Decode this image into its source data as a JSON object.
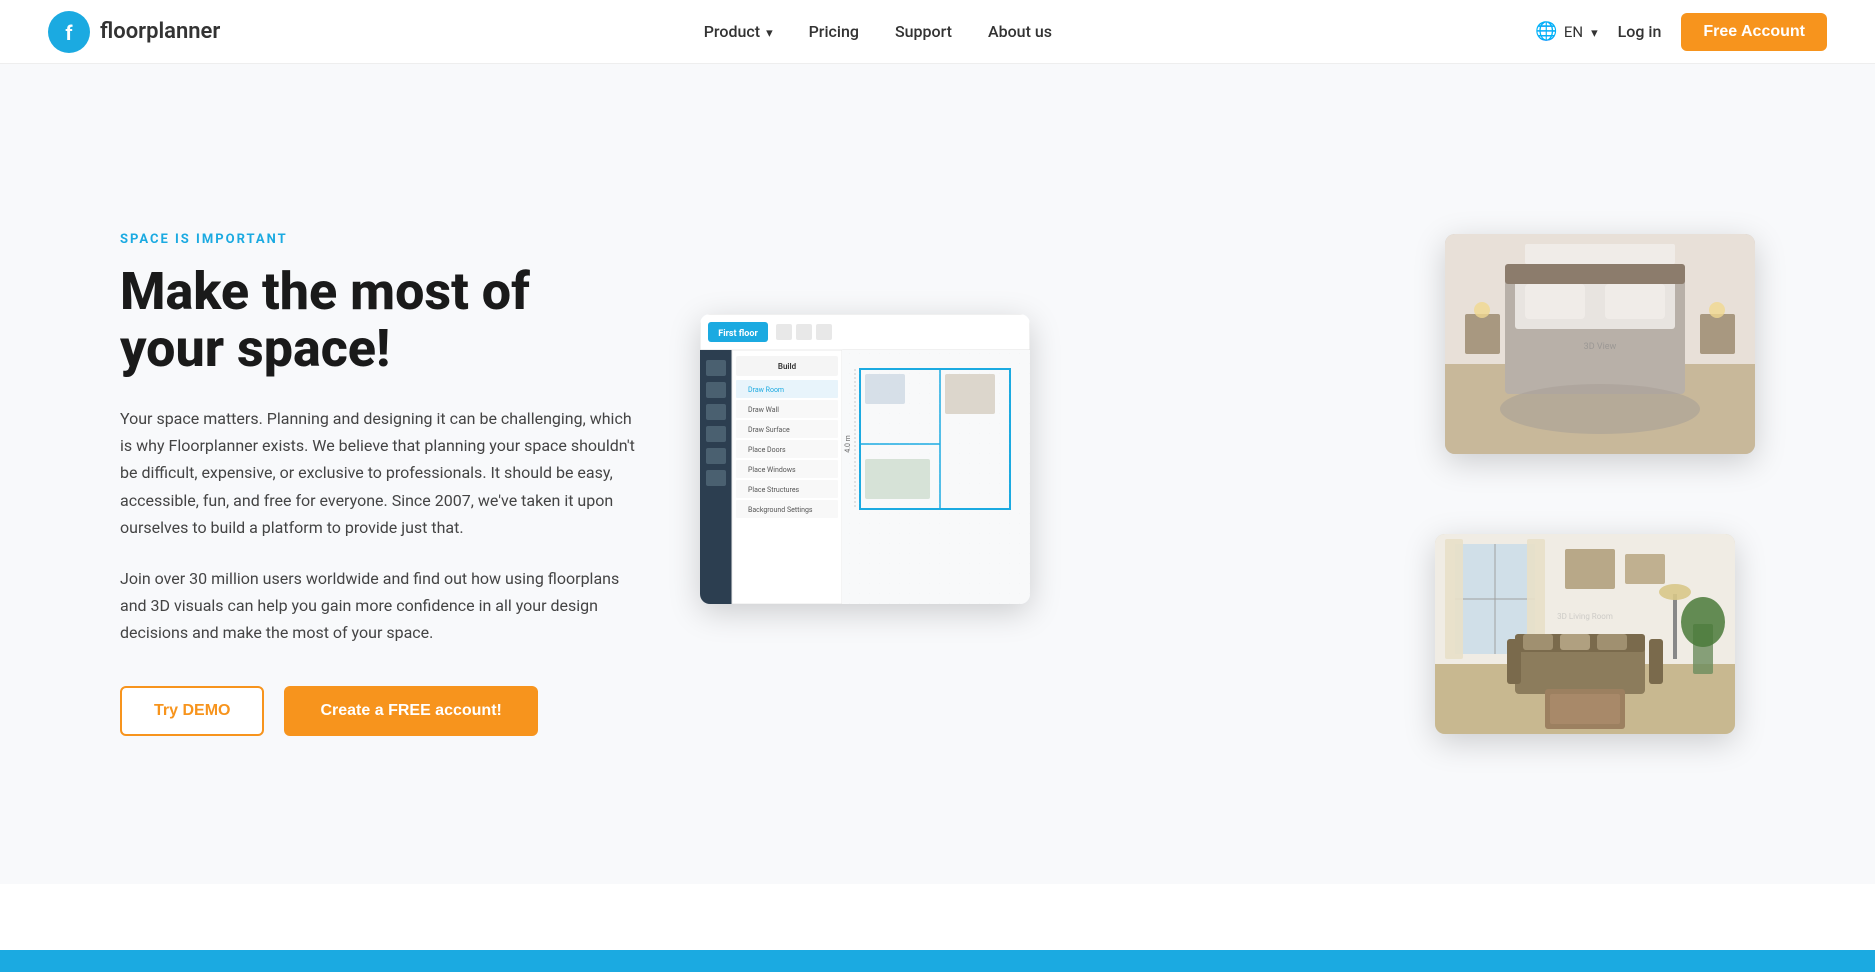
{
  "brand": {
    "name": "floorplanner",
    "logo_alt": "Floorplanner logo"
  },
  "nav": {
    "links": [
      {
        "id": "product",
        "label": "Product",
        "has_dropdown": true
      },
      {
        "id": "pricing",
        "label": "Pricing",
        "has_dropdown": false
      },
      {
        "id": "support",
        "label": "Support",
        "has_dropdown": false
      },
      {
        "id": "about",
        "label": "About us",
        "has_dropdown": false
      }
    ],
    "lang": "EN",
    "login_label": "Log in",
    "free_account_label": "Free Account"
  },
  "hero": {
    "eyebrow": "SPACE IS IMPORTANT",
    "title": "Make the most of your space!",
    "body1": "Your space matters. Planning and designing it can be challenging, which is why Floorplanner exists. We believe that planning your space shouldn't be difficult, expensive, or exclusive to professionals. It should be easy, accessible, fun, and free for everyone. Since 2007, we've taken it upon ourselves to build a platform to provide just that.",
    "body2": "Join over 30 million users worldwide and find out how using floorplans and 3D visuals can help you gain more confidence in all your design decisions and make the most of your space.",
    "btn_demo": "Try DEMO",
    "btn_create": "Create a FREE account!"
  },
  "colors": {
    "brand_blue": "#1baae1",
    "brand_orange": "#f7941d",
    "text_dark": "#1a1a1a",
    "text_body": "#444444"
  }
}
